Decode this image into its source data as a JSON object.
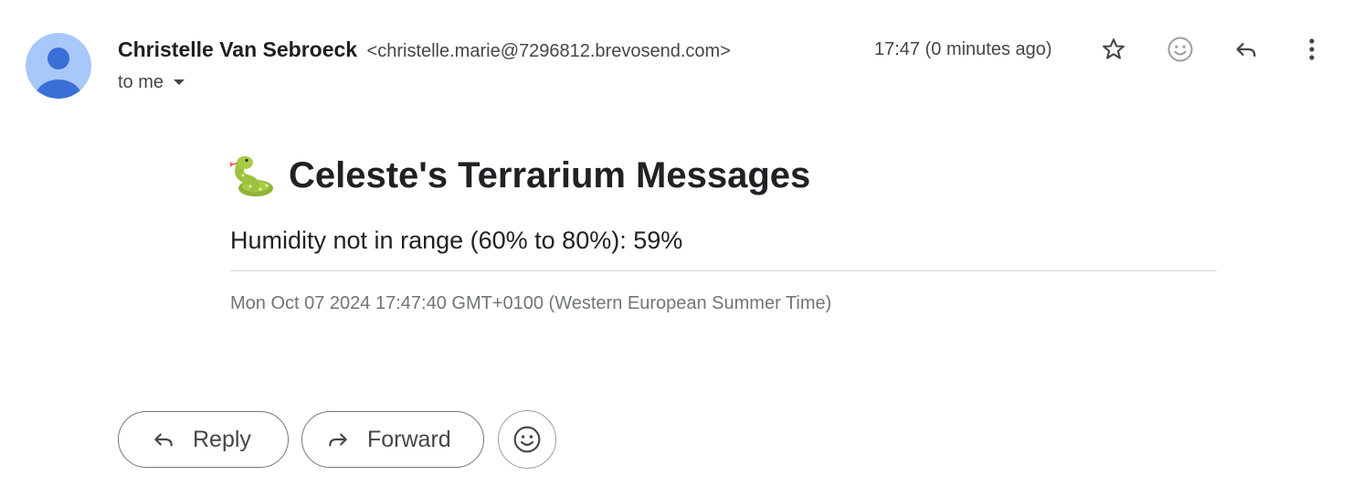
{
  "header": {
    "sender_name": "Christelle Van Sebroeck",
    "sender_email": "<christelle.marie@7296812.brevosend.com>",
    "recipient_label": "to me",
    "timestamp": "17:47 (0 minutes ago)",
    "icons": [
      "star-icon",
      "emoji-react-icon",
      "reply-icon",
      "more-vert-icon"
    ],
    "avatar_color": "#a8c7fa",
    "avatar_figure_color": "#3a6fd8"
  },
  "message": {
    "title_emoji": "snake",
    "title": "Celeste's Terrarium Messages",
    "alert": "Humidity not in range (60% to 80%): 59%",
    "date": "Mon Oct 07 2024 17:47:40 GMT+0100 (Western European Summer Time)"
  },
  "actions": {
    "reply_label": "Reply",
    "forward_label": "Forward",
    "emoji_button_icon": "emoji-react-icon"
  }
}
